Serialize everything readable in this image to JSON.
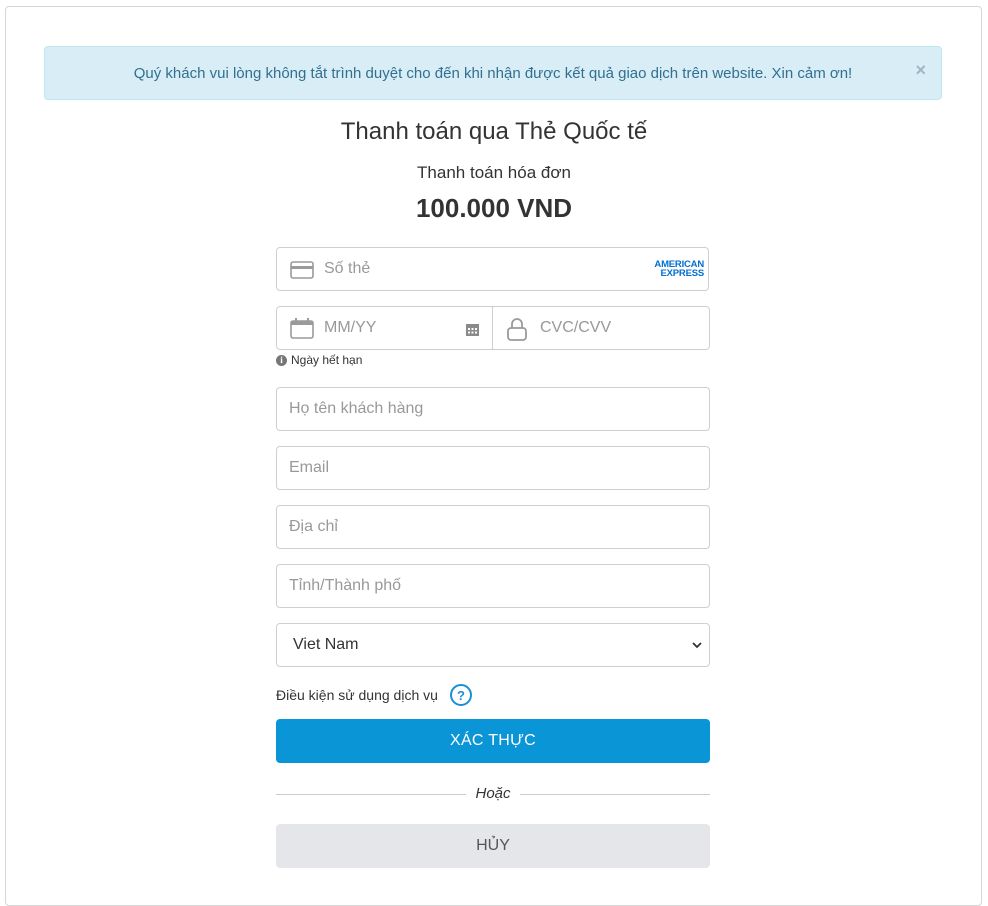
{
  "alert": {
    "message": "Quý khách vui lòng không tắt trình duyệt cho đến khi nhận được kết quả giao dịch trên website. Xin cảm ơn!",
    "close_label": "×"
  },
  "header": {
    "title": "Thanh toán qua Thẻ Quốc tế",
    "subtitle": "Thanh toán hóa đơn",
    "amount": "100.000 VND"
  },
  "card": {
    "number_placeholder": "Số thẻ",
    "brand_line1": "AMERICAN",
    "brand_line2": "EXPRESS",
    "expiry_placeholder": "MM/YY",
    "cvc_placeholder": "CVC/CVV",
    "expiry_hint": "Ngày hết hạn"
  },
  "customer": {
    "name_placeholder": "Họ tên khách hàng",
    "email_placeholder": "Email",
    "address_placeholder": "Địa chỉ",
    "city_placeholder": "Tỉnh/Thành phố",
    "country_selected": "Viet Nam"
  },
  "terms": {
    "label": "Điều kiện sử dụng dịch vụ",
    "help_symbol": "?"
  },
  "actions": {
    "confirm_label": "XÁC THỰC",
    "or_label": "Hoặc",
    "cancel_label": "HỦY"
  },
  "colors": {
    "primary": "#0a95d6",
    "alert_bg": "#d9edf7",
    "alert_text": "#31708f",
    "amex_blue": "#016fd0"
  }
}
